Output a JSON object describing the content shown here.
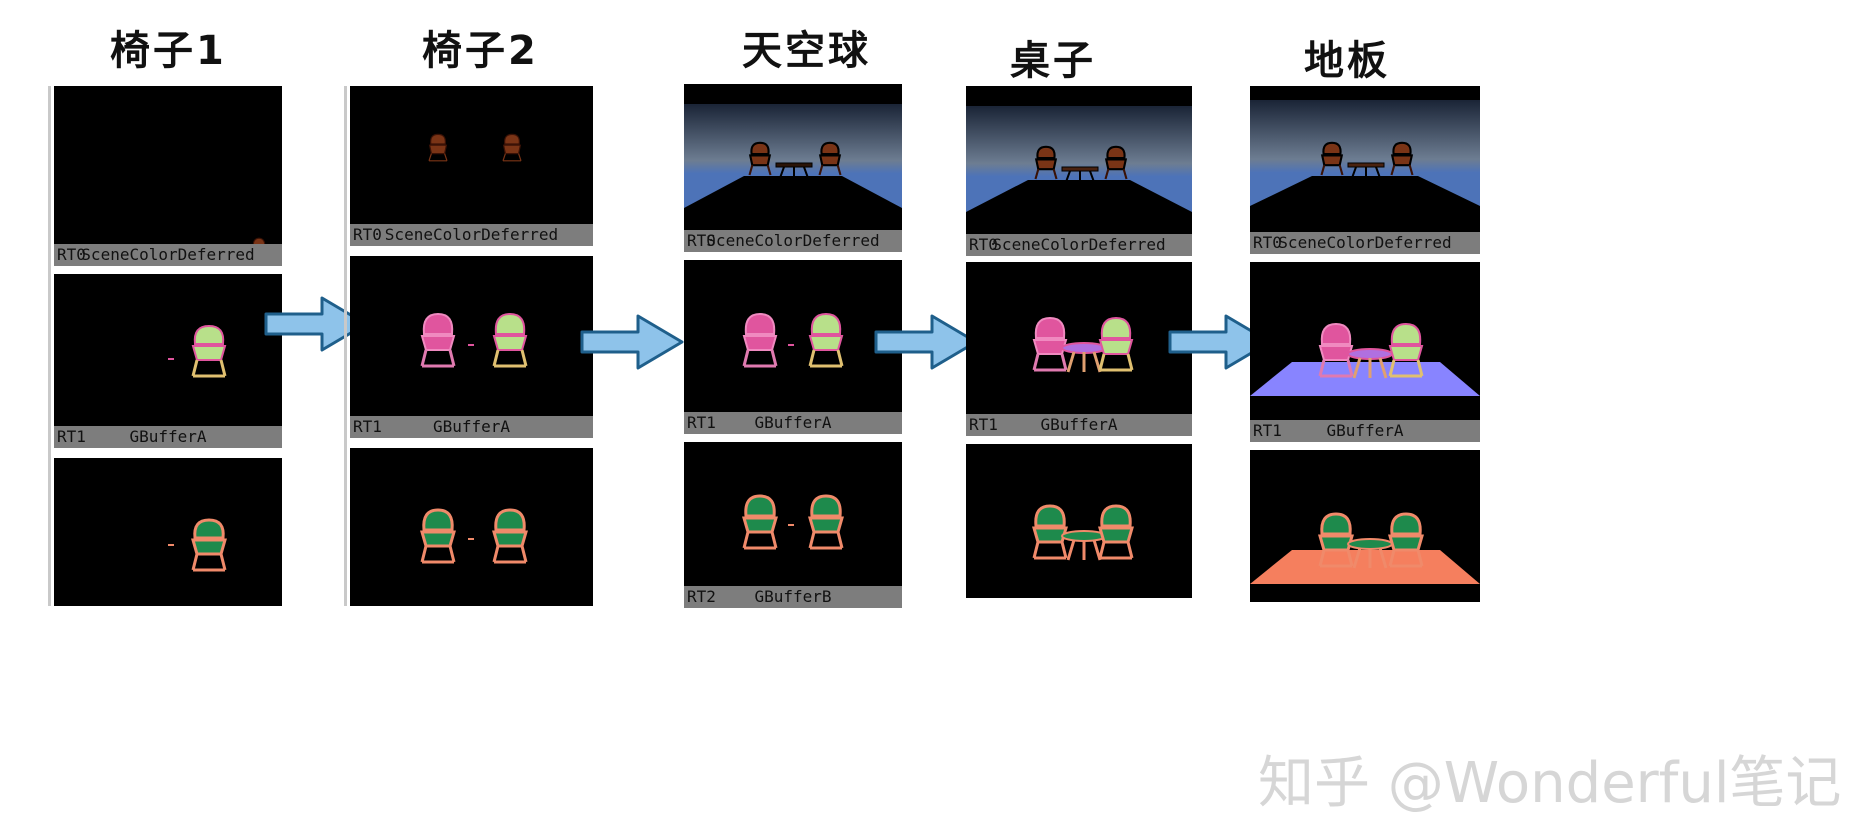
{
  "columns": [
    {
      "title": "椅子1",
      "panels": [
        {
          "rt": "RT0",
          "name": "SceneColorDeferred"
        },
        {
          "rt": "RT1",
          "name": "GBufferA"
        },
        {
          "rt": "",
          "name": ""
        }
      ]
    },
    {
      "title": "椅子2",
      "panels": [
        {
          "rt": "RT0",
          "name": "SceneColorDeferred"
        },
        {
          "rt": "RT1",
          "name": "GBufferA"
        },
        {
          "rt": "",
          "name": ""
        }
      ]
    },
    {
      "title": "天空球",
      "panels": [
        {
          "rt": "RT0",
          "name": "SceneColorDeferred"
        },
        {
          "rt": "RT1",
          "name": "GBufferA"
        },
        {
          "rt": "RT2",
          "name": "GBufferB"
        }
      ]
    },
    {
      "title": "桌子",
      "panels": [
        {
          "rt": "RT0",
          "name": "SceneColorDeferred"
        },
        {
          "rt": "RT1",
          "name": "GBufferA"
        },
        {
          "rt": "",
          "name": ""
        }
      ]
    },
    {
      "title": "地板",
      "panels": [
        {
          "rt": "RT0",
          "name": "SceneColorDeferred"
        },
        {
          "rt": "RT1",
          "name": "GBufferA"
        },
        {
          "rt": "",
          "name": ""
        }
      ]
    }
  ],
  "watermark": "知乎 @Wonderful笔记",
  "colors": {
    "arrow_fill": "#8ec3ea",
    "arrow_stroke": "#1f5f8b",
    "label_bg": "#7d7d7d",
    "sky": "#4d73b8",
    "chair_scene": "#7a3416",
    "gbuffer_a_pink": "#e0559e",
    "gbuffer_a_green": "#b8e08a",
    "gbuffer_b_green": "#1e8a4c",
    "gbuffer_b_outline": "#f08a6a",
    "floor_a": "#8884ff",
    "floor_b": "#f57f5e"
  },
  "icons": [
    "right-arrow-icon"
  ]
}
